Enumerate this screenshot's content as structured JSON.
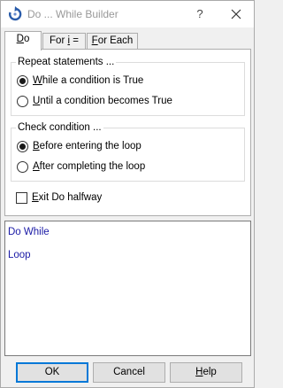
{
  "window": {
    "title": "Do ... While Builder",
    "help_glyph": "?",
    "app_icon": "loop-arrow-icon",
    "close_icon": "close-icon"
  },
  "tabs": [
    {
      "pre": "",
      "mnemonic": "D",
      "post": "o",
      "active": true
    },
    {
      "pre": "For ",
      "mnemonic": "i",
      "post": " =",
      "active": false
    },
    {
      "pre": "",
      "mnemonic": "F",
      "post": "or Each",
      "active": false
    }
  ],
  "repeat_group": {
    "label": "Repeat statements ...",
    "options": [
      {
        "pre": "",
        "mnemonic": "W",
        "post": "hile a condition is True",
        "selected": true
      },
      {
        "pre": "",
        "mnemonic": "U",
        "post": "ntil a condition becomes True",
        "selected": false
      }
    ]
  },
  "check_group": {
    "label": "Check condition ...",
    "options": [
      {
        "pre": "",
        "mnemonic": "B",
        "post": "efore entering the loop",
        "selected": true
      },
      {
        "pre": "",
        "mnemonic": "A",
        "post": "fter completing the loop",
        "selected": false
      }
    ]
  },
  "exit_checkbox": {
    "pre": "",
    "mnemonic": "E",
    "post": "xit Do halfway",
    "checked": false
  },
  "code_preview": {
    "lines": [
      "Do While",
      "Loop"
    ],
    "color": "#1a1aa6"
  },
  "buttons": {
    "ok": "OK",
    "cancel": "Cancel",
    "help_pre": "",
    "help_mnemonic": "H",
    "help_post": "elp"
  },
  "colors": {
    "accent": "#0078d7",
    "title_text": "#999999"
  }
}
